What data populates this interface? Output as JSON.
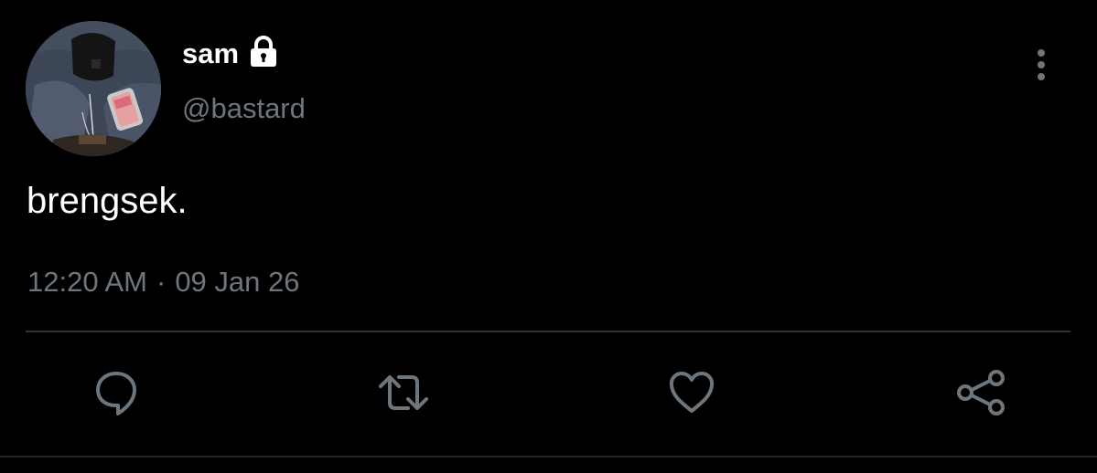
{
  "user": {
    "display_name": "sam",
    "handle": "@bastard",
    "protected_icon": "lock-icon",
    "avatar_icon": "profile-avatar"
  },
  "tweet": {
    "text": "brengsek.",
    "time": "12:20 AM",
    "separator": "·",
    "date": "09 Jan 26"
  },
  "actions": {
    "reply_icon": "reply-icon",
    "retweet_icon": "retweet-icon",
    "like_icon": "heart-icon",
    "share_icon": "share-icon"
  },
  "colors": {
    "background": "#000000",
    "primary_text": "#ffffff",
    "secondary_text": "#6e767d",
    "divider": "#2f3336"
  }
}
